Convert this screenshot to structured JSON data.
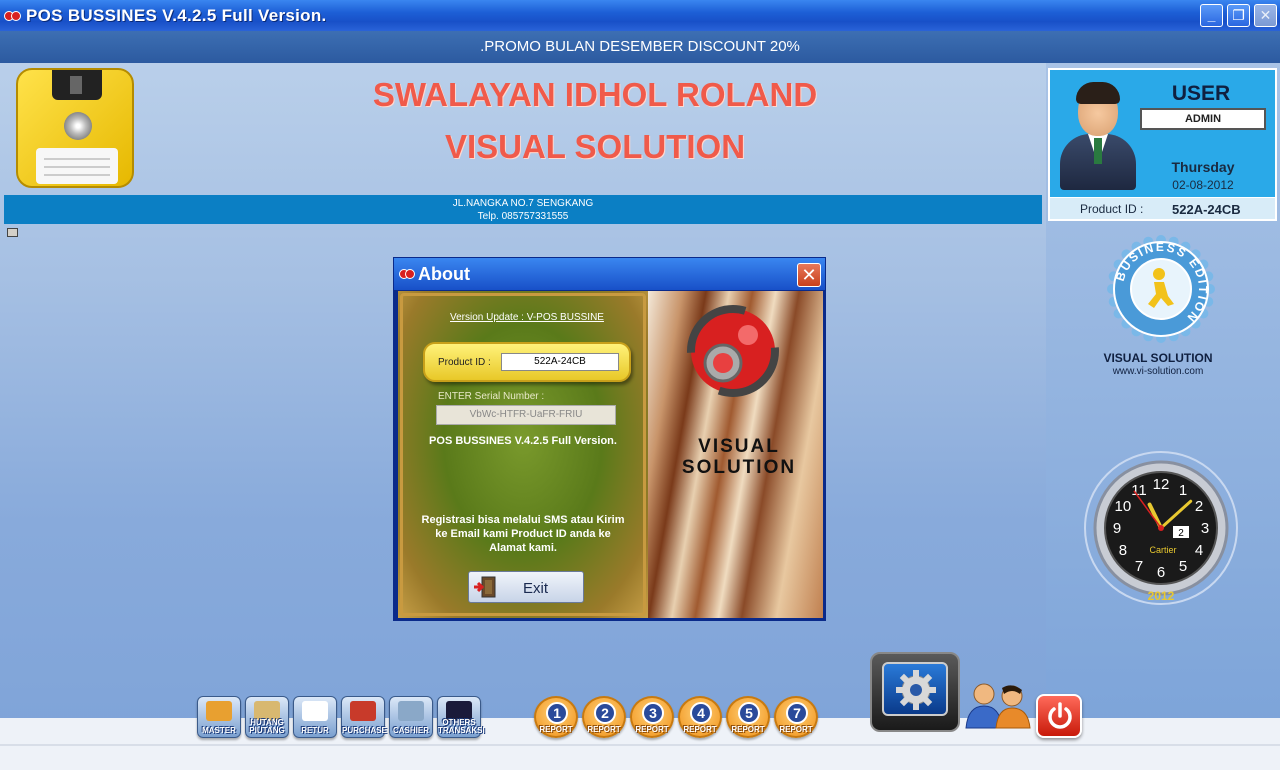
{
  "window": {
    "title": "POS BUSSINES V.4.2.5 Full Version.",
    "minimize": "_",
    "restore": "❐",
    "close": "✕"
  },
  "promo": ".PROMO BULAN DESEMBER DISCOUNT 20%",
  "store": {
    "name": "SWALAYAN IDHOL ROLAND",
    "subtitle": "VISUAL SOLUTION",
    "address": "JL.NANGKA NO.7 SENGKANG",
    "phone": "Telp. 085757331555"
  },
  "user_panel": {
    "label": "USER",
    "value": "ADMIN",
    "day": "Thursday",
    "date": "02-08-2012",
    "product_id_label": "Product ID :",
    "product_id": "522A-24CB"
  },
  "badge": {
    "ring_text": "BUSINESS EDITION",
    "caption": "VISUAL SOLUTION",
    "url": "www.vi-solution.com"
  },
  "clock": {
    "numbers": [
      "12",
      "1",
      "2",
      "3",
      "4",
      "5",
      "6",
      "7",
      "8",
      "9",
      "10",
      "11"
    ],
    "date_window": "2",
    "brand": "Cartier",
    "year": "2012",
    "time": {
      "hour": 11,
      "minute": 8,
      "second": 54
    }
  },
  "about": {
    "title": "About",
    "close": "✕",
    "version_update": "Version Update : V-POS BUSSINE",
    "product_id_label": "Product ID :",
    "product_id": "522A-24CB",
    "serial_label": "ENTER Serial Number :",
    "serial_value": "VbWc-HTFR-UaFR-FRIU",
    "version_text": "POS BUSSINES V.4.2.5 Full Version.",
    "registration_text": "Registrasi bisa melalui SMS atau Kirim ke Email kami Product ID anda ke Alamat kami.",
    "exit_label": "Exit",
    "logo_line1": "VISUAL",
    "logo_line2": "SOLUTION"
  },
  "nav": [
    {
      "label": "MASTER",
      "color": "#e8a030"
    },
    {
      "label": "HUTANG PIUTANG",
      "color": "#d8b870"
    },
    {
      "label": "RETUR",
      "color": "#ffffff"
    },
    {
      "label": "PURCHASE",
      "color": "#c83a2a"
    },
    {
      "label": "CASHIER",
      "color": "#8aa8c8"
    },
    {
      "label": "OTHERS TRANSAKSI",
      "color": "#1a1a3a"
    }
  ],
  "reports": [
    {
      "number": "1",
      "label": "REPORT"
    },
    {
      "number": "2",
      "label": "REPORT"
    },
    {
      "number": "3",
      "label": "REPORT"
    },
    {
      "number": "4",
      "label": "REPORT"
    },
    {
      "number": "5",
      "label": "REPORT"
    },
    {
      "number": "7",
      "label": "REPORT"
    }
  ]
}
